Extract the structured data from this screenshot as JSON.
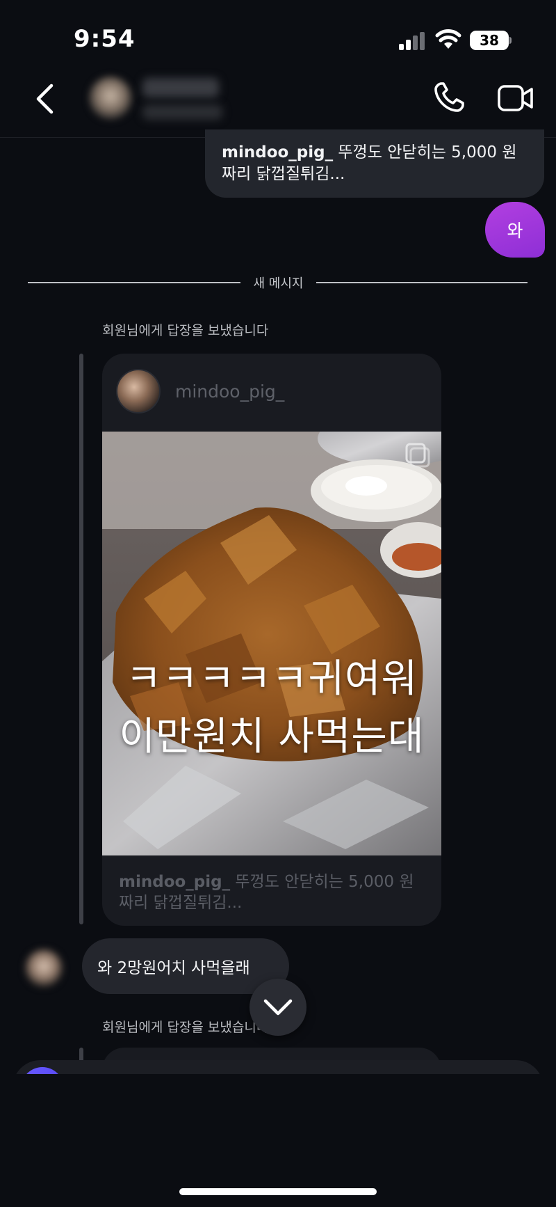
{
  "status_bar": {
    "time": "9:54",
    "battery": "38",
    "icons": [
      "signal-icon",
      "wifi-icon",
      "battery-icon"
    ]
  },
  "header": {
    "icons": [
      "back-chevron-icon",
      "phone-icon",
      "video-camera-icon"
    ]
  },
  "thread": {
    "top_reply": {
      "username": "mindoo_pig_",
      "caption": " 뚜껑도 안닫히는 5,000 원짜리 닭껍질튀김..."
    },
    "my_message": "와",
    "new_messages_divider": "새 메시지",
    "reply_context_1": "회원님에게 답장을 보냈습니다",
    "post_card": {
      "username": "mindoo_pig_",
      "overlay_line1": "ㅋㅋㅋㅋㅋ귀여워",
      "overlay_line2": "이만원치 사먹는대",
      "caption_username": "mindoo_pig_",
      "caption": " 뚜껑도 안닫히는 5,000 원짜리 닭껍질튀김..."
    },
    "incoming_message": "와 2망원어치 사먹을래",
    "reply_context_2": "회원님에게 답장을 보냈습니다"
  },
  "colors": {
    "background": "#0b0d12",
    "bubble_incoming": "#24262d",
    "bubble_outgoing": "#9b35dc"
  }
}
